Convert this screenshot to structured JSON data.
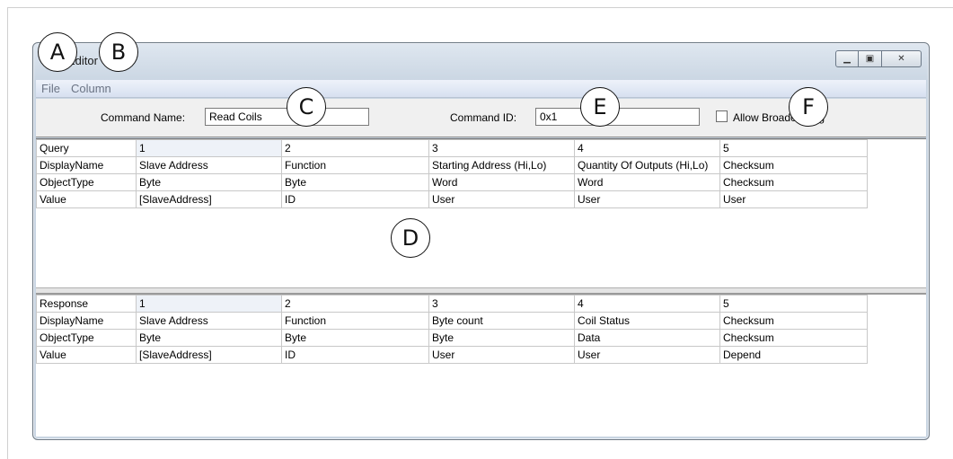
{
  "window": {
    "title": "Command Editor",
    "title_visible": "Editor",
    "minimize_icon": "minimize-icon",
    "maximize_icon": "maximize-icon",
    "close_icon": "close-icon"
  },
  "menu": {
    "items": [
      "File",
      "Column"
    ]
  },
  "toolbar": {
    "command_name_label": "Command Name:",
    "command_name_value": "Read Coils",
    "command_id_label": "Command ID:",
    "command_id_value": "0x1",
    "allow_broadcast_label": "Allow Broadcasting",
    "allow_broadcast_checked": false
  },
  "query_table": {
    "rows": [
      [
        "Query",
        "1",
        "2",
        "3",
        "4",
        "5"
      ],
      [
        "DisplayName",
        "Slave Address",
        "Function",
        "Starting Address (Hi,Lo)",
        "Quantity Of Outputs (Hi,Lo)",
        "Checksum"
      ],
      [
        "ObjectType",
        "Byte",
        "Byte",
        "Word",
        "Word",
        "Checksum"
      ],
      [
        "Value",
        "[SlaveAddress]",
        "ID",
        "User",
        "User",
        "User"
      ]
    ]
  },
  "response_table": {
    "rows": [
      [
        "Response",
        "1",
        "2",
        "3",
        "4",
        "5"
      ],
      [
        "DisplayName",
        "Slave Address",
        "Function",
        "Byte count",
        "Coil Status",
        "Checksum"
      ],
      [
        "ObjectType",
        "Byte",
        "Byte",
        "Byte",
        "Data",
        "Checksum"
      ],
      [
        "Value",
        "[SlaveAddress]",
        "ID",
        "User",
        "User",
        "Depend"
      ]
    ]
  },
  "callouts": [
    "A",
    "B",
    "C",
    "D",
    "E",
    "F"
  ]
}
